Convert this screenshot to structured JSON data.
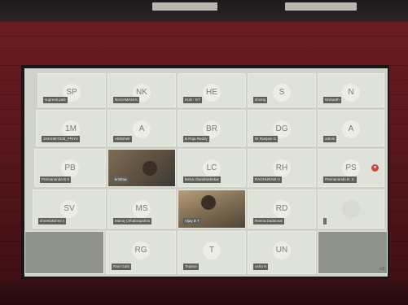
{
  "participants": [
    {
      "initials": "SP",
      "name": "supreeti patil"
    },
    {
      "initials": "NK",
      "name": "NAGAMANI K"
    },
    {
      "initials": "HE",
      "name": "HoD - ET"
    },
    {
      "initials": "S",
      "name": "shivraj"
    },
    {
      "initials": "N",
      "name": "Nishanth"
    },
    {
      "initials": "1M",
      "name": "1NH19ET038_PRIYA"
    },
    {
      "initials": "A",
      "name": "Abhishek"
    },
    {
      "initials": "BR",
      "name": "B Roja Reddy"
    },
    {
      "initials": "DG",
      "name": "Dr Ranjani G"
    },
    {
      "initials": "A",
      "name": "admin"
    },
    {
      "initials": "PB",
      "name": "Premananda B S"
    },
    {
      "initials": "",
      "name": "krishna",
      "video": true
    },
    {
      "initials": "LC",
      "name": "leena chandrashekar"
    },
    {
      "initials": "RH",
      "name": "RAGHURAM H"
    },
    {
      "initials": "PS",
      "name": "Premananda B. S."
    },
    {
      "initials": "SV",
      "name": "shreelakshmi v"
    },
    {
      "initials": "MS",
      "name": "Manoj Chhabrapalli B"
    },
    {
      "initials": "",
      "name": "Vijay B T",
      "video": true
    },
    {
      "initials": "RD",
      "name": "Reena Dadarwal"
    },
    {
      "initials": "",
      "name": ""
    },
    {
      "initials": "RG",
      "name": "Ravi Gatti"
    },
    {
      "initials": "T",
      "name": "Tejaswi"
    },
    {
      "initials": "UN",
      "name": "usha N"
    }
  ],
  "ui": {
    "record_icon": "record-icon",
    "page_counter": "+3"
  },
  "colors": {
    "tile": "#dfe2d9",
    "label_bg": "#5e605a",
    "avatar_text": "#7a7c6f"
  }
}
